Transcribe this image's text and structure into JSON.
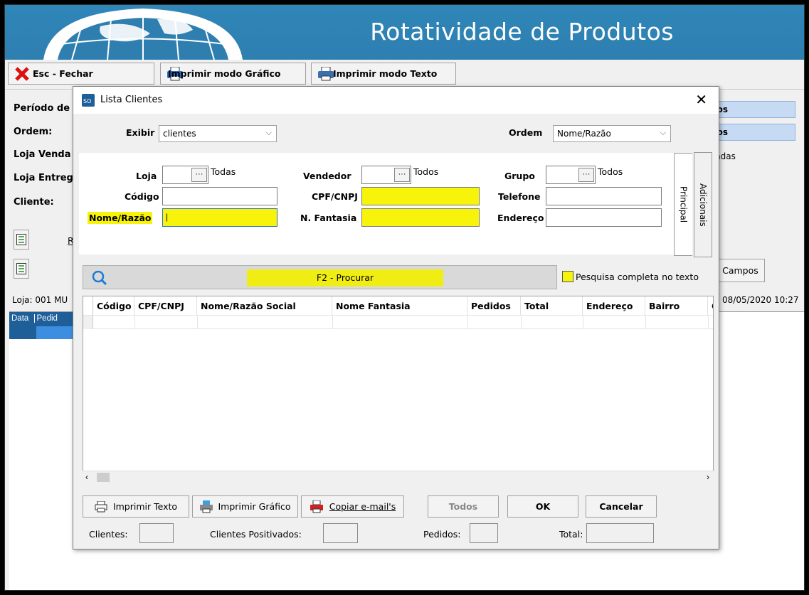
{
  "window": {
    "title": "Rotatividade de Produtos"
  },
  "toolbar": {
    "close_label": "Esc - Fechar",
    "print_graphic_label": "Imprimir modo Gráfico",
    "print_text_label": "Imprimir modo Texto"
  },
  "background": {
    "periodo_label": "Período de",
    "ordem_label": "Ordem:",
    "loja_venda_label": "Loja Venda",
    "loja_entrega_label": "Loja Entreg",
    "cliente_label": "Cliente:",
    "field1_value": "dos",
    "field2_value": "dos",
    "field3_value": "ndas",
    "campos_label": "r Campos",
    "loja_status": "Loja: 001 MU",
    "timestamp": "08/05/2020 10:27",
    "grid_col1": "Data",
    "grid_col2": "Pedid",
    "side_letter": "R"
  },
  "dialog": {
    "title": "Lista Clientes",
    "exibir_label": "Exibir",
    "exibir_value": "clientes",
    "ordem_label": "Ordem",
    "ordem_value": "Nome/Razão",
    "loja_label": "Loja",
    "loja_all": "Todas",
    "vendedor_label": "Vendedor",
    "vendedor_all": "Todos",
    "grupo_label": "Grupo",
    "grupo_all": "Todos",
    "codigo_label": "Código",
    "cpf_label": "CPF/CNPJ",
    "telefone_label": "Telefone",
    "nome_label": "Nome/Razão",
    "fantasia_label": "N. Fantasia",
    "endereco_label": "Endereço",
    "tab_principal": "Principal",
    "tab_adicionais": "Adicionais",
    "search_button": "F2 - Procurar",
    "full_text_label": "Pesquisa completa no texto",
    "columns": [
      "Código",
      "CPF/CNPJ",
      "Nome/Razão Social",
      "Nome Fantasia",
      "Pedidos",
      "Total",
      "Endereço",
      "Bairro",
      "C"
    ],
    "btn_print_text": "Imprimir Texto",
    "btn_print_graphic": "Imprimir Gráfico",
    "btn_copy_emails": "Copiar e-mail's",
    "btn_todos": "Todos",
    "btn_ok": "OK",
    "btn_cancel": "Cancelar",
    "clientes_label": "Clientes:",
    "positivados_label": "Clientes Positivados:",
    "pedidos_label": "Pedidos:",
    "total_label": "Total:"
  }
}
